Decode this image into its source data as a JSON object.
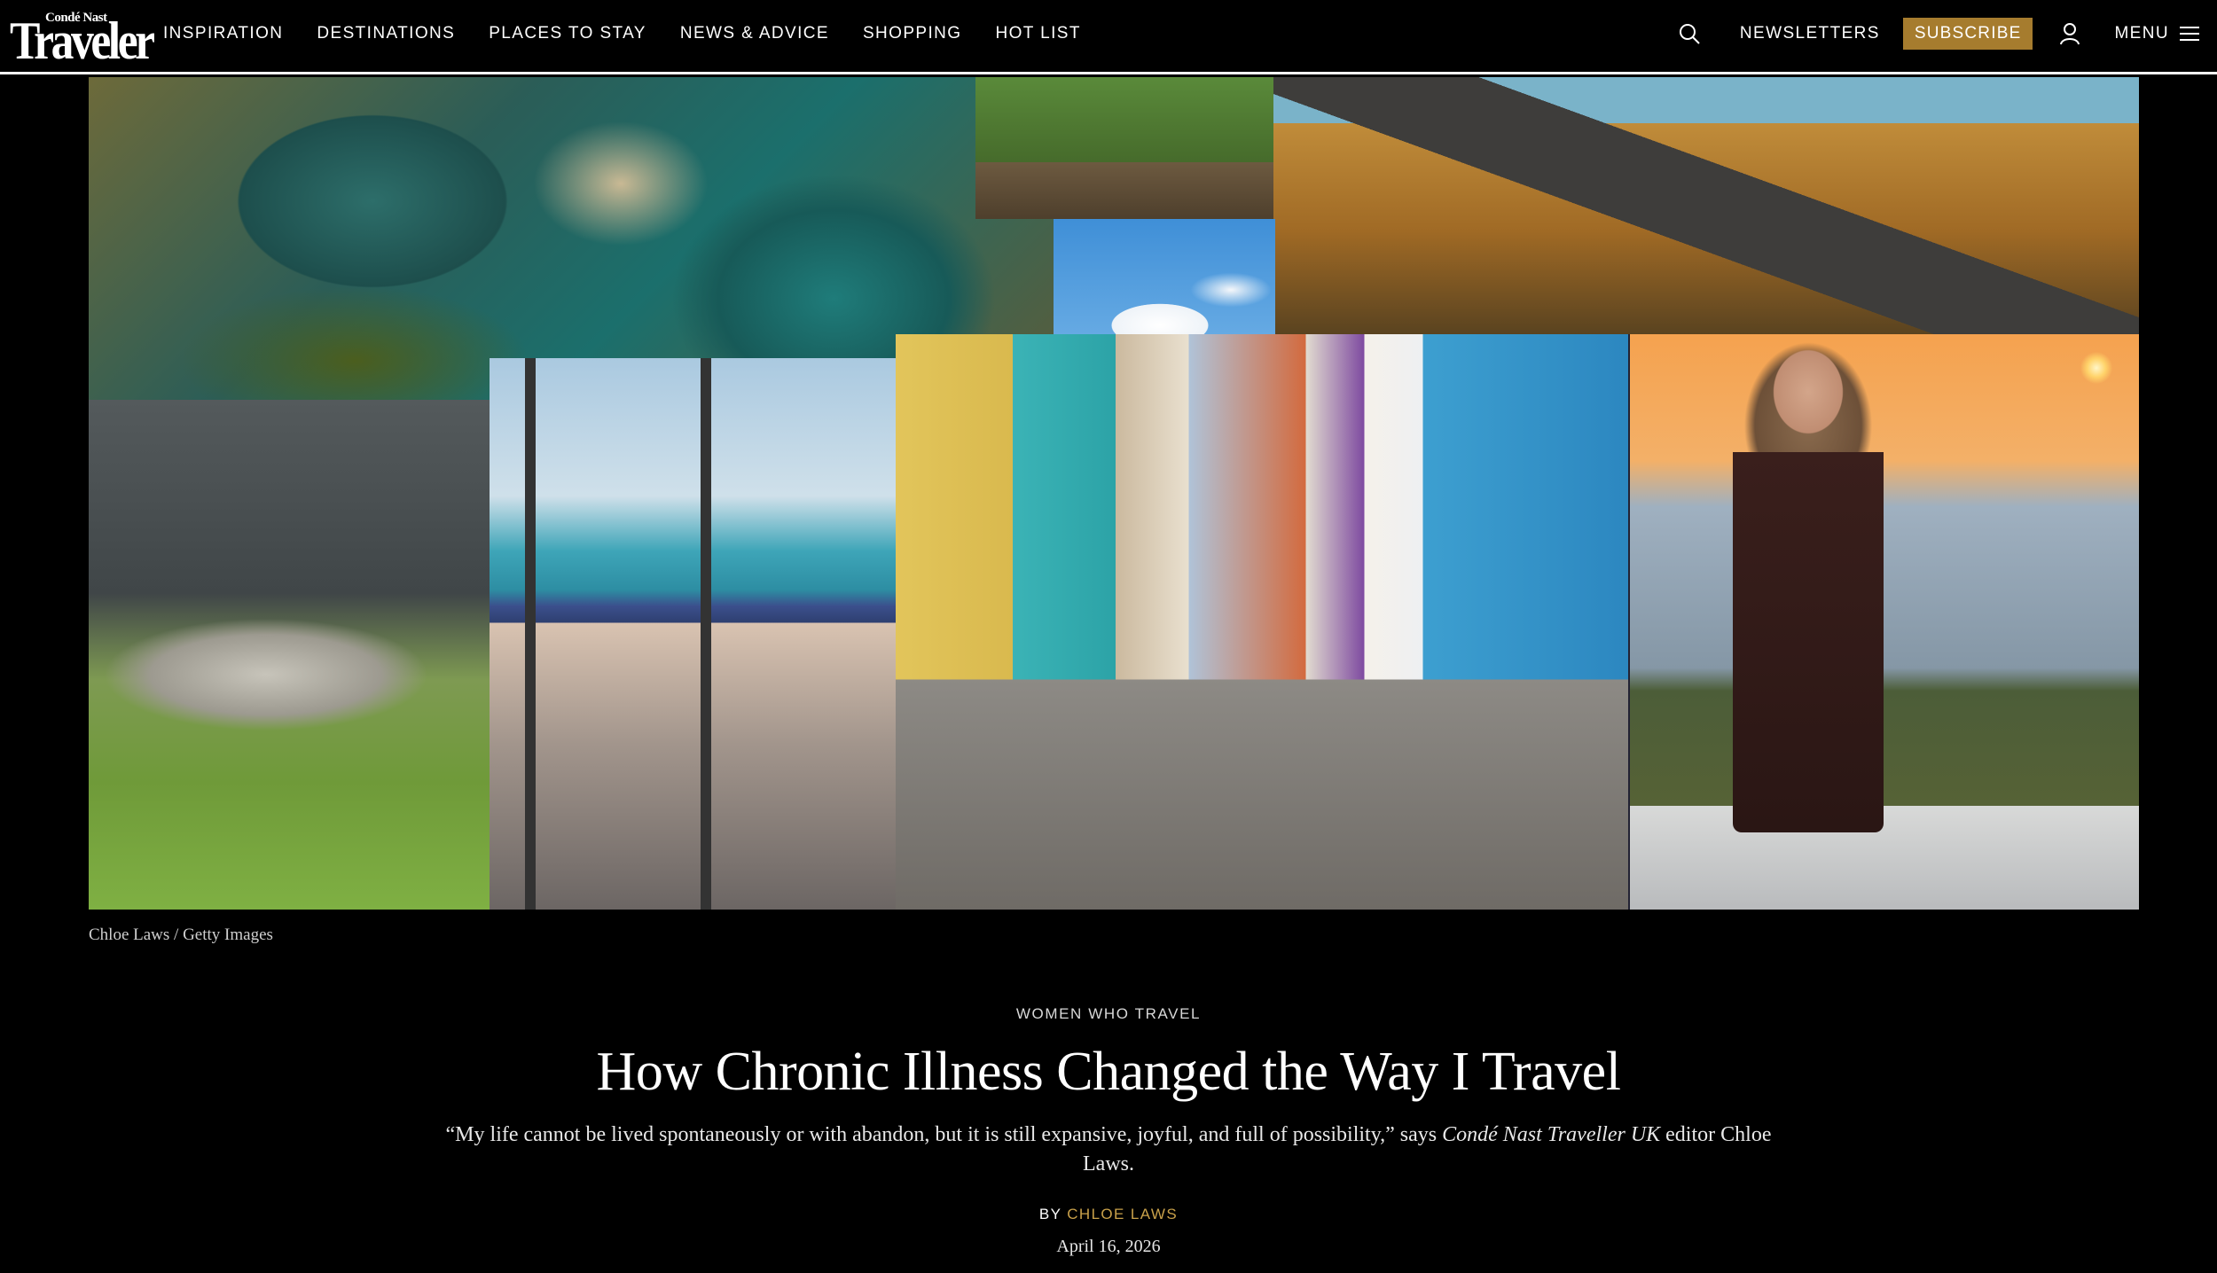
{
  "logo": {
    "small": "Condé Nast",
    "big": "Traveler"
  },
  "nav": {
    "links": [
      "INSPIRATION",
      "DESTINATIONS",
      "PLACES TO STAY",
      "NEWS & ADVICE",
      "SHOPPING",
      "HOT LIST"
    ],
    "newsletters": "NEWSLETTERS",
    "subscribe": "SUBSCRIBE",
    "menu": "MENU"
  },
  "hero": {
    "caption": "Chloe Laws / Getty Images"
  },
  "article": {
    "rubric": "WOMEN WHO TRAVEL",
    "headline": "How Chronic Illness Changed the Way I Travel",
    "dek_start": "“My life cannot be lived spontaneously or with abandon, but it is still expansive, joyful, and full of possibility,” says ",
    "dek_italic": "Condé Nast Traveller UK",
    "dek_end": " editor Chloe Laws.",
    "byline_prefix": "BY ",
    "author": "CHLOE LAWS",
    "date": "April 16, 2026"
  },
  "colors": {
    "accent": "#a67c2e",
    "author": "#c9a14a",
    "background": "#000000"
  }
}
